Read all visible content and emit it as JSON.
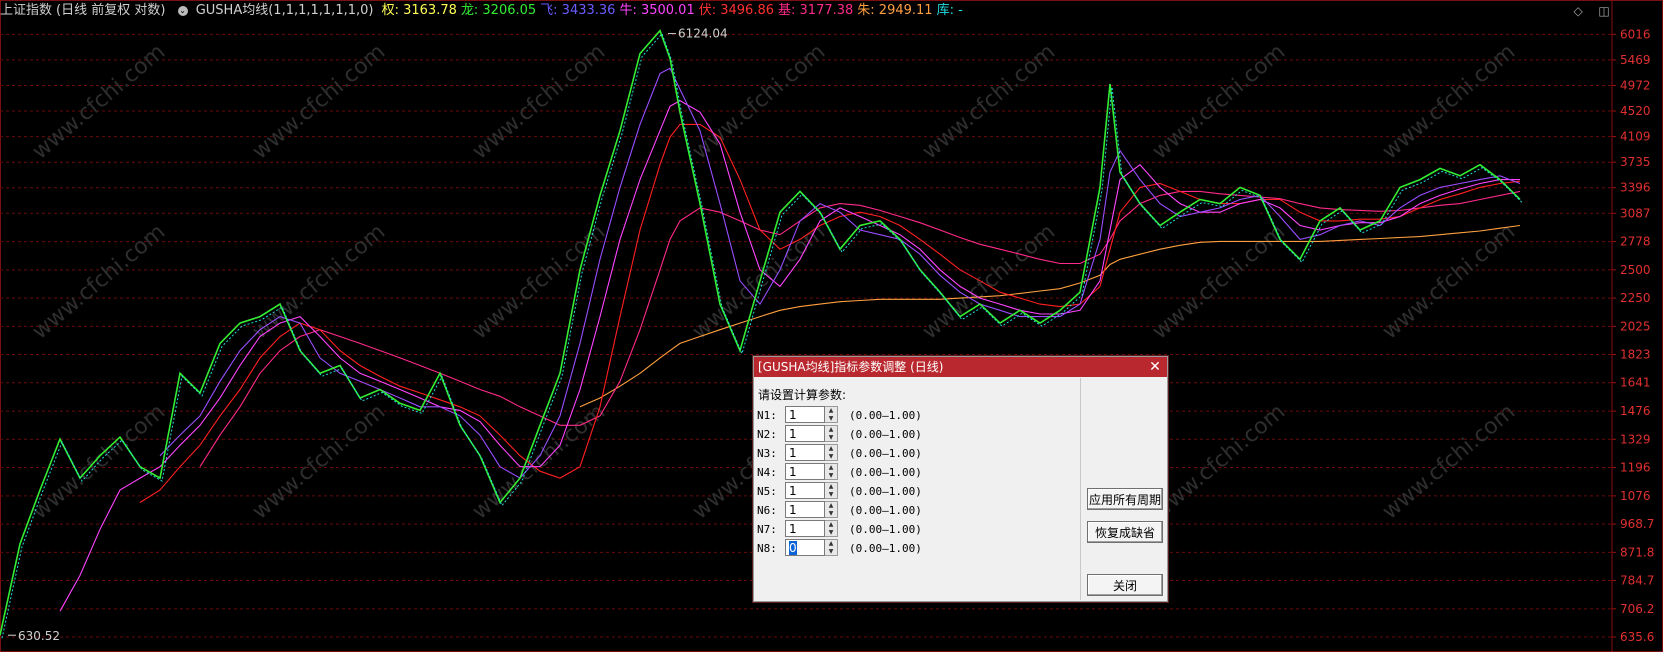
{
  "header": {
    "index_name": "上证指数",
    "index_mode": "(日线 前复权 对数)",
    "indicator_name": "GUSHA均线(1,1,1,1,1,1,1,0)",
    "values": [
      {
        "label": "权:",
        "value": "3163.78",
        "color": "#ffff55"
      },
      {
        "label": "龙:",
        "value": "3206.05",
        "color": "#33ee33"
      },
      {
        "label": "飞:",
        "value": "3433.36",
        "color": "#6a5cff"
      },
      {
        "label": "牛:",
        "value": "3500.01",
        "color": "#ff44ff"
      },
      {
        "label": "伏:",
        "value": "3496.86",
        "color": "#ff3030"
      },
      {
        "label": "基:",
        "value": "3177.38",
        "color": "#ff2a8a"
      },
      {
        "label": "朱:",
        "value": "2949.11",
        "color": "#ffa040"
      },
      {
        "label": "库:",
        "value": "-",
        "color": "#22dddd"
      }
    ]
  },
  "window_controls": {
    "diamond_icon": "◇",
    "panel_icon": "◫"
  },
  "chart_data": {
    "type": "line",
    "title": "",
    "yscale": "log",
    "ylim": [
      624,
      6300
    ],
    "y_ticks": [
      6016,
      5469,
      4972,
      4520,
      4109,
      3735,
      3396,
      3087,
      2778,
      2500,
      2250,
      2025,
      1823,
      1641,
      1476,
      1329,
      1196,
      1076,
      968.7,
      871.8,
      784.7,
      706.2,
      635.6
    ],
    "annotations": [
      {
        "text": "6124.04",
        "x": 668,
        "value": 6124.04
      },
      {
        "text": "630.52",
        "x": 8,
        "value": 630.52
      }
    ],
    "x": [
      0,
      20,
      40,
      60,
      80,
      100,
      120,
      140,
      160,
      180,
      200,
      220,
      240,
      260,
      280,
      300,
      320,
      340,
      360,
      380,
      400,
      420,
      440,
      460,
      480,
      500,
      520,
      540,
      560,
      580,
      600,
      620,
      640,
      660,
      670,
      680,
      700,
      720,
      740,
      760,
      780,
      800,
      820,
      840,
      860,
      880,
      900,
      920,
      940,
      960,
      980,
      1000,
      1020,
      1040,
      1060,
      1080,
      1100,
      1110,
      1120,
      1140,
      1160,
      1180,
      1200,
      1220,
      1240,
      1260,
      1280,
      1300,
      1320,
      1340,
      1360,
      1380,
      1400,
      1420,
      1440,
      1460,
      1480,
      1500,
      1520
    ],
    "series": [
      {
        "name": "price",
        "color": "#33ee33",
        "values": [
          640,
          900,
          1100,
          1330,
          1150,
          1250,
          1340,
          1200,
          1150,
          1700,
          1580,
          1900,
          2050,
          2100,
          2200,
          1850,
          1700,
          1750,
          1550,
          1600,
          1520,
          1480,
          1700,
          1400,
          1250,
          1050,
          1150,
          1400,
          1700,
          2500,
          3300,
          4200,
          5600,
          6100,
          5500,
          4500,
          3200,
          2200,
          1850,
          2400,
          3100,
          3350,
          3100,
          2700,
          2950,
          3000,
          2800,
          2500,
          2300,
          2100,
          2200,
          2050,
          2150,
          2050,
          2150,
          2300,
          3400,
          5000,
          3600,
          3200,
          2950,
          3100,
          3250,
          3200,
          3400,
          3300,
          2800,
          2600,
          3000,
          3150,
          2900,
          3000,
          3400,
          3500,
          3650,
          3550,
          3700,
          3500,
          3250
        ]
      },
      {
        "name": "MA-purple",
        "color": "#9a4dff",
        "values": [
          null,
          null,
          null,
          null,
          null,
          null,
          null,
          null,
          1250,
          1350,
          1450,
          1650,
          1850,
          2000,
          2100,
          2050,
          1800,
          1700,
          1650,
          1600,
          1550,
          1500,
          1500,
          1450,
          1350,
          1200,
          1150,
          1250,
          1450,
          1900,
          2600,
          3400,
          4300,
          5200,
          5300,
          4900,
          4200,
          3200,
          2400,
          2200,
          2500,
          3000,
          3200,
          3100,
          2900,
          2850,
          2800,
          2650,
          2450,
          2300,
          2200,
          2150,
          2100,
          2100,
          2100,
          2200,
          2800,
          3600,
          3900,
          3500,
          3200,
          3050,
          3100,
          3150,
          3250,
          3300,
          3050,
          2800,
          2850,
          2950,
          3000,
          2950,
          3150,
          3300,
          3400,
          3450,
          3500,
          3550,
          3450
        ]
      },
      {
        "name": "MA-magenta",
        "color": "#ff44ff",
        "values": [
          null,
          null,
          null,
          700,
          800,
          950,
          1100,
          1150,
          1200,
          1300,
          1400,
          1550,
          1750,
          1950,
          2050,
          2100,
          1950,
          1800,
          1700,
          1650,
          1600,
          1550,
          1500,
          1480,
          1420,
          1300,
          1200,
          1200,
          1300,
          1600,
          2100,
          2800,
          3500,
          4200,
          4600,
          4700,
          4500,
          4000,
          3100,
          2500,
          2350,
          2600,
          3000,
          3150,
          3050,
          2950,
          2850,
          2700,
          2500,
          2350,
          2250,
          2200,
          2150,
          2120,
          2120,
          2150,
          2400,
          2900,
          3500,
          3700,
          3400,
          3200,
          3100,
          3100,
          3200,
          3250,
          3150,
          2950,
          2900,
          2950,
          2980,
          2980,
          3050,
          3200,
          3300,
          3380,
          3450,
          3500,
          3500
        ]
      },
      {
        "name": "MA-red",
        "color": "#ff2020",
        "values": [
          null,
          null,
          null,
          null,
          null,
          null,
          null,
          1050,
          1100,
          1200,
          1300,
          1450,
          1600,
          1800,
          1950,
          2050,
          2000,
          1850,
          1750,
          1680,
          1620,
          1580,
          1540,
          1500,
          1450,
          1350,
          1250,
          1180,
          1150,
          1200,
          1500,
          2100,
          2900,
          3700,
          4100,
          4300,
          4300,
          4100,
          3500,
          2900,
          2700,
          2800,
          2950,
          3050,
          3100,
          3050,
          2950,
          2800,
          2650,
          2500,
          2400,
          2300,
          2250,
          2200,
          2180,
          2200,
          2350,
          2700,
          3100,
          3400,
          3450,
          3350,
          3250,
          3200,
          3200,
          3250,
          3250,
          3100,
          3000,
          3000,
          3020,
          3020,
          3050,
          3150,
          3250,
          3320,
          3400,
          3450,
          3480
        ]
      },
      {
        "name": "MA-crimson",
        "color": "#ff2a8a",
        "values": [
          null,
          null,
          null,
          null,
          null,
          null,
          null,
          null,
          null,
          null,
          1200,
          1350,
          1500,
          1700,
          1850,
          1950,
          2000,
          1950,
          1900,
          1850,
          1800,
          1750,
          1700,
          1650,
          1600,
          1560,
          1500,
          1450,
          1400,
          1400,
          1450,
          1650,
          2000,
          2500,
          2800,
          3000,
          3150,
          3100,
          3000,
          2900,
          2850,
          3000,
          3150,
          3200,
          3180,
          3120,
          3050,
          2980,
          2900,
          2820,
          2750,
          2700,
          2650,
          2600,
          2560,
          2560,
          2650,
          2800,
          3000,
          3200,
          3300,
          3350,
          3350,
          3320,
          3300,
          3280,
          3260,
          3200,
          3150,
          3130,
          3120,
          3110,
          3120,
          3150,
          3180,
          3200,
          3250,
          3300,
          3350
        ]
      },
      {
        "name": "MA-orange",
        "color": "#ffa040",
        "values": [
          null,
          null,
          null,
          null,
          null,
          null,
          null,
          null,
          null,
          null,
          null,
          null,
          null,
          null,
          null,
          null,
          null,
          null,
          null,
          null,
          null,
          null,
          null,
          null,
          null,
          null,
          null,
          null,
          null,
          1500,
          1550,
          1620,
          1700,
          1800,
          1850,
          1900,
          1950,
          2000,
          2050,
          2100,
          2150,
          2180,
          2200,
          2220,
          2230,
          2240,
          2240,
          2240,
          2240,
          2250,
          2260,
          2270,
          2290,
          2310,
          2330,
          2380,
          2450,
          2550,
          2600,
          2650,
          2700,
          2740,
          2770,
          2780,
          2780,
          2780,
          2780,
          2780,
          2780,
          2790,
          2800,
          2810,
          2820,
          2830,
          2850,
          2870,
          2890,
          2920,
          2950
        ]
      }
    ]
  },
  "watermark": "www.cfchi.com",
  "dialog": {
    "title": "[GUSHA均线]指标参数调整 (日线)",
    "close_icon": "✕",
    "prompt": "请设置计算参数:",
    "params": [
      {
        "label": "N1:",
        "value": "1",
        "range": "(0.00—1.00)"
      },
      {
        "label": "N2:",
        "value": "1",
        "range": "(0.00—1.00)"
      },
      {
        "label": "N3:",
        "value": "1",
        "range": "(0.00—1.00)"
      },
      {
        "label": "N4:",
        "value": "1",
        "range": "(0.00—1.00)"
      },
      {
        "label": "N5:",
        "value": "1",
        "range": "(0.00—1.00)"
      },
      {
        "label": "N6:",
        "value": "1",
        "range": "(0.00—1.00)"
      },
      {
        "label": "N7:",
        "value": "1",
        "range": "(0.00—1.00)"
      },
      {
        "label": "N8:",
        "value": "0",
        "range": "(0.00—1.00)"
      }
    ],
    "buttons": {
      "apply_all": "应用所有周期",
      "restore_default": "恢复成缺省",
      "close": "关闭"
    }
  }
}
